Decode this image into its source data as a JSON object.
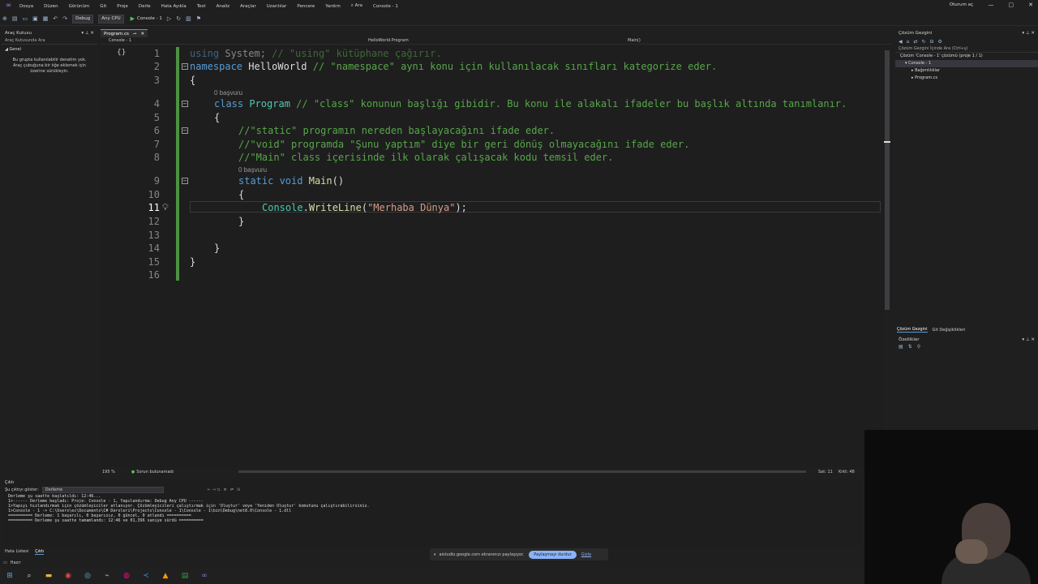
{
  "menubar": {
    "items": [
      "Dosya",
      "Düzen",
      "Görünüm",
      "Git",
      "Proje",
      "Derle",
      "Hata Ayıkla",
      "Test",
      "Analiz",
      "Araçlar",
      "Uzantılar",
      "Pencere",
      "Yardım"
    ],
    "search": "Ara",
    "solution_name": "Console - 1",
    "account": "Oturum aç"
  },
  "toolbar": {
    "config": "Debug",
    "platform": "Any CPU",
    "run_target": "Console - 1"
  },
  "toolbox": {
    "title": "Araç Kutusu",
    "search": "Araç Kutusunda Ara",
    "group": "Genel",
    "message": "Bu grupta kullanılabilir denetim yok. Araç çubuğuna bir öğe eklemek için üzerine sürükleyin."
  },
  "editor": {
    "tab_label": "Program.cs",
    "project_dropdown": "Console - 1",
    "class_dropdown": "HelloWorld.Program",
    "member_dropdown": "Main()",
    "ref_lens_1": "0 başvuru",
    "ref_lens_2": "0 başvuru",
    "lines": {
      "l1_kw": "using",
      "l1_txt": " System; ",
      "l1_cm": "// \"using\" kütüphane çağırır.",
      "l2_kw": "namespace",
      "l2_txt": " HelloWorld ",
      "l2_cm": "// \"namespace\" aynı konu için kullanılacak sınıfları kategorize eder.",
      "l3": "{",
      "l4_kw": "class",
      "l4_ty": " Program",
      "l4_cm": " // \"class\" konunun başlığı gibidir. Bu konu ile alakalı ifadeler bu başlık altında tanımlanır.",
      "l5": "{",
      "l6_cm": "//\"static\" programın nereden başlayacağını ifade eder.",
      "l7_cm": "//\"void\" programda \"Şunu yaptım\" diye bir geri dönüş olmayacağını ifade eder.",
      "l8_cm": "//\"Main\" class içerisinde ilk olarak çalışacak kodu temsil eder.",
      "l9_kw": "static void",
      "l9_fn": "Main",
      "l9_txt": "()",
      "l10": "{",
      "l11_ty": "Console",
      "l11_dot": ".",
      "l11_fn": "WriteLine",
      "l11_p1": "(",
      "l11_st": "\"Merhaba Dünya\"",
      "l11_p2": ");",
      "l12": "}",
      "l14": "}",
      "l15": "}"
    },
    "line_numbers": [
      "1",
      "2",
      "3",
      "4",
      "5",
      "6",
      "7",
      "8",
      "9",
      "10",
      "11",
      "12",
      "13",
      "14",
      "15",
      "16"
    ]
  },
  "editor_status": {
    "zoom": "195 %",
    "issues": "Sorun bulunamadı",
    "line": "Sat: 11",
    "char": "Krkt: 48"
  },
  "solution_explorer": {
    "title": "Çözüm Gezgini",
    "search": "Çözüm Gezgini İçinde Ara (Ctrl+ş)",
    "solution": "Çözüm 'Console - 1' çözümü (proje 1 / 1)",
    "project": "Console - 1",
    "dependencies": "Bağımlılıklar",
    "file": "Program.cs",
    "tab_solution": "Çözüm Gezgini",
    "tab_git": "Git Değişiklikleri",
    "properties_title": "Özellikler"
  },
  "output": {
    "title": "Çıktı",
    "show_label": "Şu çıktıyı göster:",
    "source": "Derleme",
    "lines": [
      "Derleme şu saatte başlatıldı: 12:46...",
      "1>------ Derleme başladı: Proje: Console - 1, Yapılandırma: Debug Any CPU ------",
      "1>Yapıyı hızlandırmak için çözümleyiciler atlanıyor. Çözümleyicileri çalıştırmak için 'Oluştur' veya 'Yeniden Oluştur' komutunu çalıştırabilirsiniz.",
      "1>Console - 1 -> C:\\Users\\ec\\Documents\\C# Dersleri\\Projects\\Console - 1\\Console - 1\\bin\\Debug\\net8.0\\Console - 1.dll",
      "========== Derleme: 1 başarılı, 0 başarısız, 0 güncel, 0 atlandı ==========",
      "========== Derleme şu saatte tamamlandı: 12:46 ve 01,396 saniye sürdü =========="
    ],
    "tab_errors": "Hata Listesi",
    "tab_output": "Çıktı"
  },
  "statusbar": {
    "ready": "Hazır"
  },
  "share": {
    "text": "aistudio.google.com ekranınızı paylaşıyor.",
    "stop": "Paylaşmayı durdur",
    "hide": "Gizle"
  },
  "colors": {
    "keyword": "#569cd6",
    "comment": "#57a64a",
    "type": "#4ec9b0",
    "method": "#dcdcaa",
    "string": "#d69d85"
  }
}
